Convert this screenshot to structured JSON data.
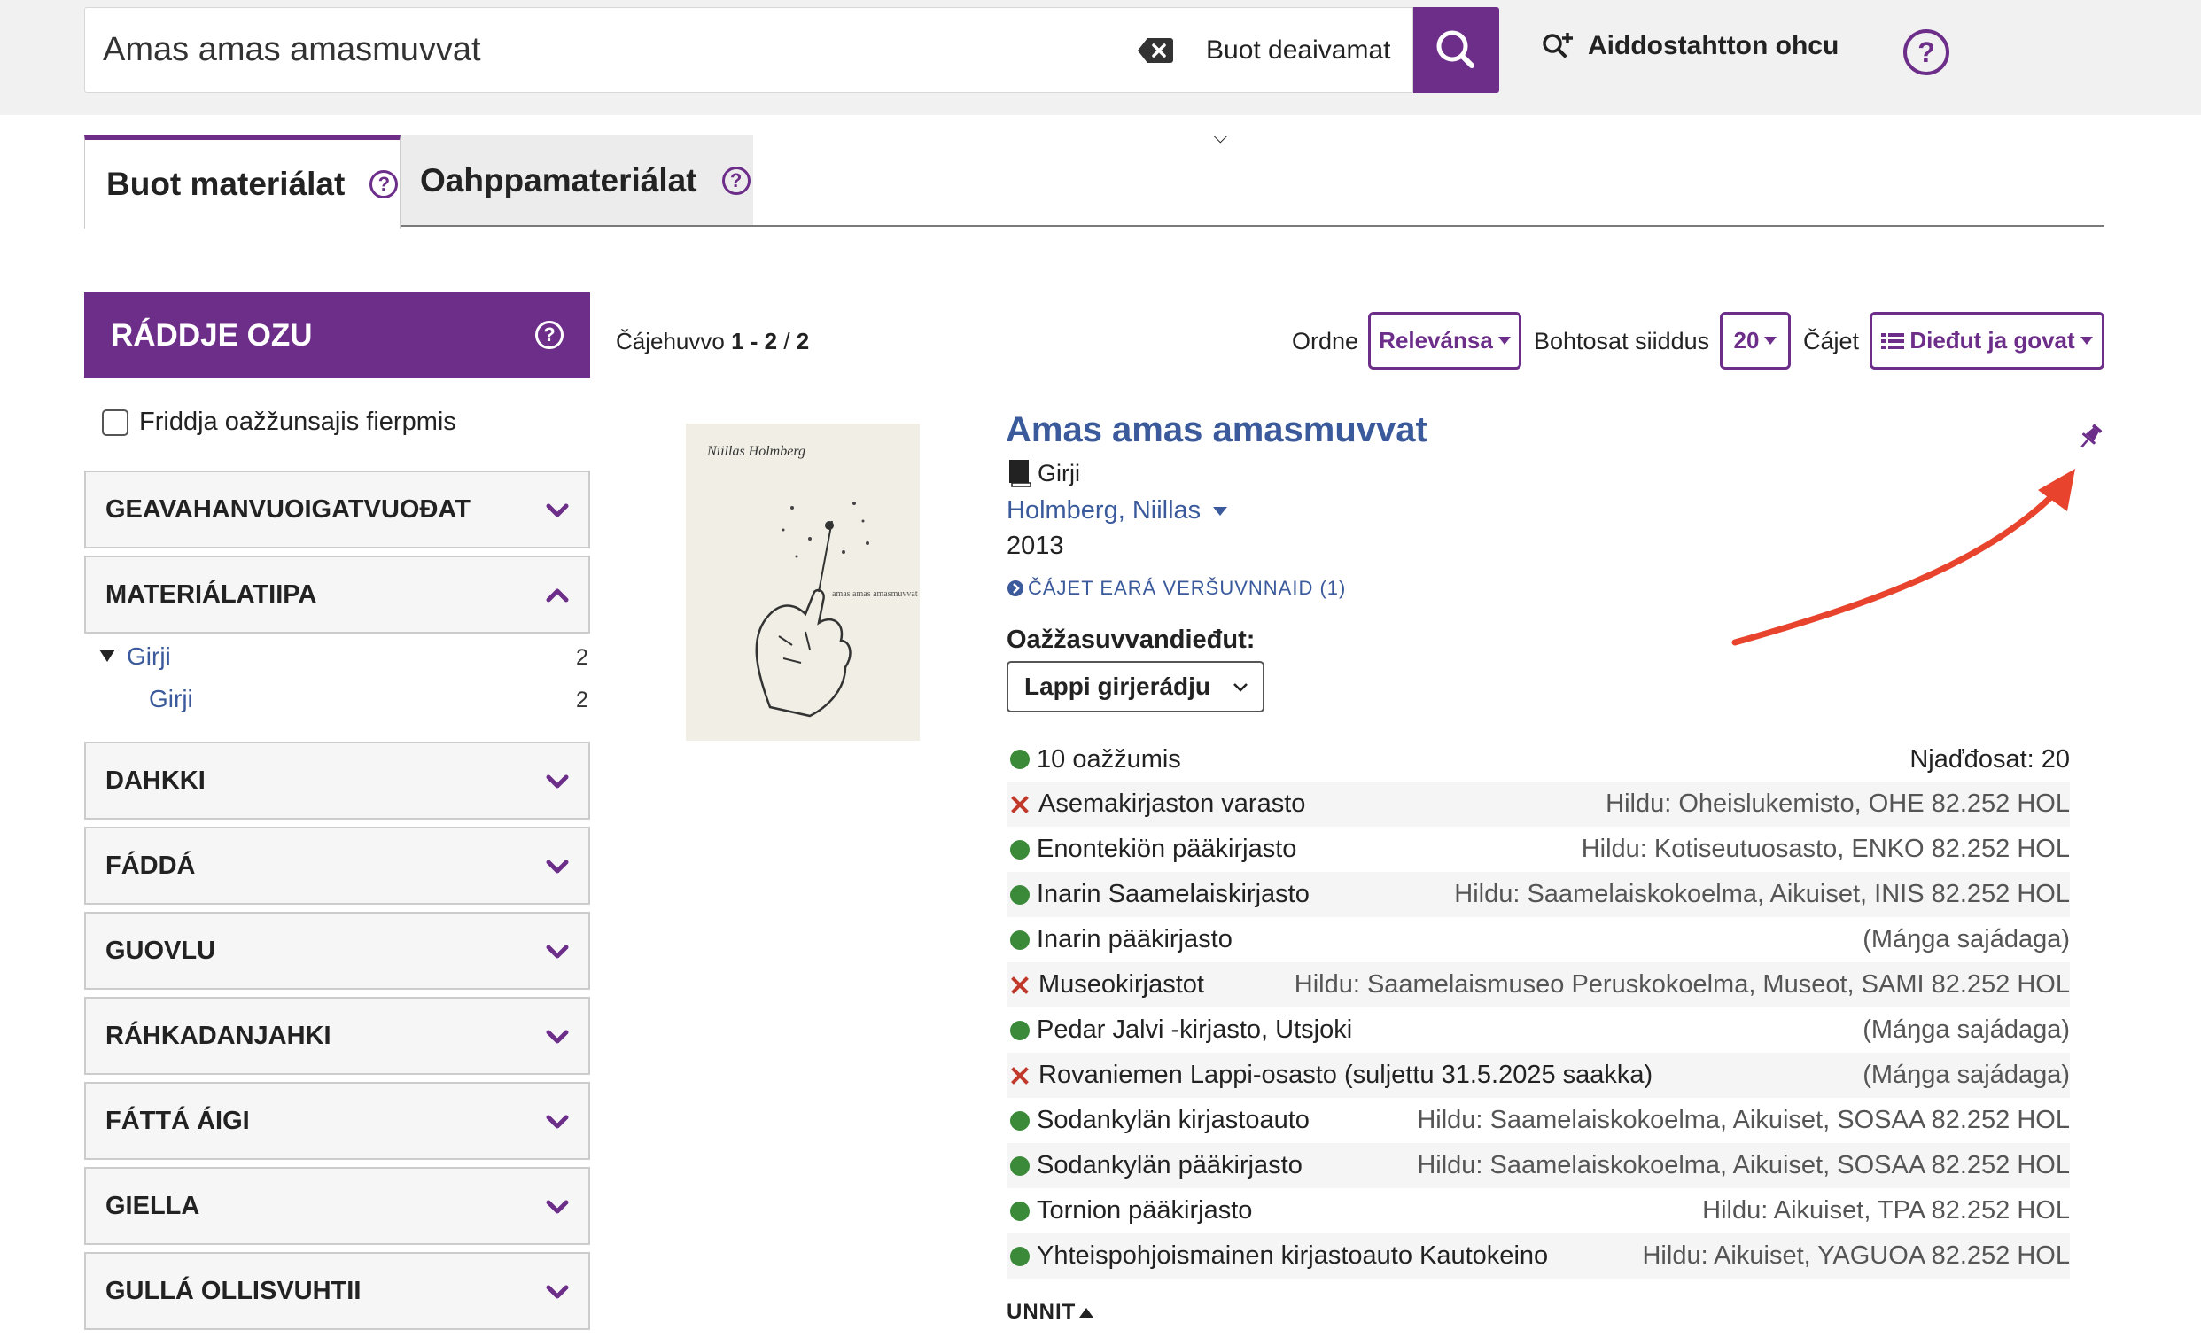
{
  "search": {
    "query": "Amas amas amasmuvvat",
    "scope_label": "Buot deaivamat",
    "advanced_label": "Aiddostahtton ohcu"
  },
  "tabs": [
    {
      "label": "Buot materiálat"
    },
    {
      "label": "Oahppamateriálat"
    }
  ],
  "facets": {
    "header": "RÁDDJE OZU",
    "filter_label": "Friddja oažžunsajis fierpmis",
    "groups": [
      {
        "label": "GEAVAHANVUOIGATVUOĐAT"
      },
      {
        "label": "MATERIÁLATIIPA"
      },
      {
        "label": "DAHKKI"
      },
      {
        "label": "FÁDDÁ"
      },
      {
        "label": "GUOVLU"
      },
      {
        "label": "RÁHKADANJAHKI"
      },
      {
        "label": "FÁTTÁ ÁIGI"
      },
      {
        "label": "GIELLA"
      },
      {
        "label": "GULLÁ OLLISVUHTII"
      }
    ],
    "material_items": [
      {
        "label": "Girji",
        "count": "2"
      },
      {
        "label": "Girji",
        "count": "2"
      }
    ]
  },
  "results": {
    "meta_prefix": "Čájehuvvo ",
    "meta_range": "1 - 2",
    "meta_sep": " / ",
    "meta_total": "2",
    "sort_label": "Ordne",
    "sort_value": "Relevánsa",
    "per_page_label": "Bohtosat siiddus",
    "per_page_value": "20",
    "view_label": "Čájet",
    "view_value": "Dieđut ja govat"
  },
  "record": {
    "title": "Amas amas amasmuvvat",
    "format": "Girji",
    "author": "Holmberg, Niillas",
    "year": "2013",
    "versions_link": "ČÁJET EARÁ VERŠUVNNAID (1)",
    "cover_author": "Niillas Holmberg",
    "cover_title": "amas amas amasmuvvat",
    "availability_label": "Oažžasuvvandieđut:",
    "region": "Lappi girjerádju",
    "summary": {
      "text": "10 oažžumis",
      "holds": "Njaďđosat: 20"
    },
    "holdings": [
      {
        "status": "unavailable",
        "library": "Asemakirjaston varasto",
        "location": "Hildu: Oheislukemisto, OHE 82.252 HOL"
      },
      {
        "status": "available",
        "library": "Enontekiön pääkirjasto",
        "location": "Hildu: Kotiseutuosasto, ENKO 82.252 HOL"
      },
      {
        "status": "available",
        "library": "Inarin Saamelaiskirjasto",
        "location": "Hildu: Saamelaiskokoelma, Aikuiset, INIS 82.252 HOL"
      },
      {
        "status": "available",
        "library": "Inarin pääkirjasto",
        "location": "(Máŋga sajádaga)"
      },
      {
        "status": "unavailable",
        "library": "Museokirjastot",
        "location": "Hildu: Saamelaismuseo Peruskokoelma, Museot, SAMI 82.252 HOL"
      },
      {
        "status": "available",
        "library": "Pedar Jalvi -kirjasto, Utsjoki",
        "location": "(Máŋga sajádaga)"
      },
      {
        "status": "unavailable",
        "library": "Rovaniemen Lappi-osasto (suljettu 31.5.2025 saakka)",
        "location": "(Máŋga sajádaga)"
      },
      {
        "status": "available",
        "library": "Sodankylän kirjastoauto",
        "location": "Hildu: Saamelaiskokoelma, Aikuiset, SOSAA 82.252 HOL"
      },
      {
        "status": "available",
        "library": "Sodankylän pääkirjasto",
        "location": "Hildu: Saamelaiskokoelma, Aikuiset, SOSAA 82.252 HOL"
      },
      {
        "status": "available",
        "library": "Tornion pääkirjasto",
        "location": "Hildu: Aikuiset, TPA 82.252 HOL"
      },
      {
        "status": "available",
        "library": "Yhteispohjoismainen kirjastoauto Kautokeino",
        "location": "Hildu: Aikuiset, YAGUOA 82.252 HOL"
      }
    ],
    "less_label": "UNNIT"
  },
  "colors": {
    "accent": "#6d2e8a",
    "link": "#3a5a9c",
    "available": "#3a8a3a",
    "unavailable": "#c0392b",
    "annotation_arrow": "#e8432c"
  }
}
